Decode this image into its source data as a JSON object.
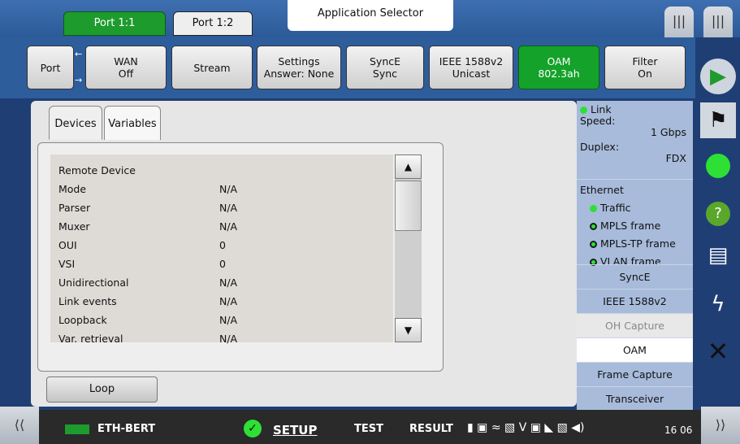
{
  "ports": [
    {
      "label": "Port 1:1"
    },
    {
      "label": "Port 1:2"
    }
  ],
  "app_selector": "Application Selector",
  "tabs": [
    {
      "line1": "Port",
      "line2": ""
    },
    {
      "line1": "WAN",
      "line2": "Off"
    },
    {
      "line1": "Stream",
      "line2": ""
    },
    {
      "line1": "Settings",
      "line2": "Answer: None"
    },
    {
      "line1": "SyncE",
      "line2": "Sync"
    },
    {
      "line1": "IEEE 1588v2",
      "line2": "Unicast"
    },
    {
      "line1": "OAM",
      "line2": "802.3ah"
    },
    {
      "line1": "Filter",
      "line2": "On"
    }
  ],
  "subtabs": [
    "Devices",
    "Variables"
  ],
  "list": {
    "header": "Remote Device",
    "rows": [
      {
        "k": "Mode",
        "v": "N/A"
      },
      {
        "k": "Parser",
        "v": "N/A"
      },
      {
        "k": "Muxer",
        "v": "N/A"
      },
      {
        "k": "OUI",
        "v": "0"
      },
      {
        "k": "VSI",
        "v": "0"
      },
      {
        "k": "Unidirectional",
        "v": "N/A"
      },
      {
        "k": "Link events",
        "v": "N/A"
      },
      {
        "k": "Loopback",
        "v": "N/A"
      },
      {
        "k": "Var. retrieval",
        "v": "N/A"
      }
    ]
  },
  "loop_label": "Loop",
  "status": {
    "link": "Link",
    "speed_label": "Speed:",
    "speed_value": "1 Gbps",
    "duplex_label": "Duplex:",
    "duplex_value": "FDX",
    "ethernet": "Ethernet",
    "traffic": "Traffic",
    "mpls": "MPLS frame",
    "mplstp": "MPLS-TP frame",
    "vlan": "VLAN frame"
  },
  "side_buttons": [
    "SyncE",
    "IEEE 1588v2",
    "OH Capture",
    "OAM",
    "Frame Capture",
    "Transceiver"
  ],
  "bottom": {
    "app": "ETH-BERT",
    "setup": "SETUP",
    "test": "TEST",
    "result": "RESULT",
    "time": "16 06"
  },
  "colors": {
    "accent_green": "#1e9b2d",
    "bg_blue": "#2e5d9c"
  }
}
